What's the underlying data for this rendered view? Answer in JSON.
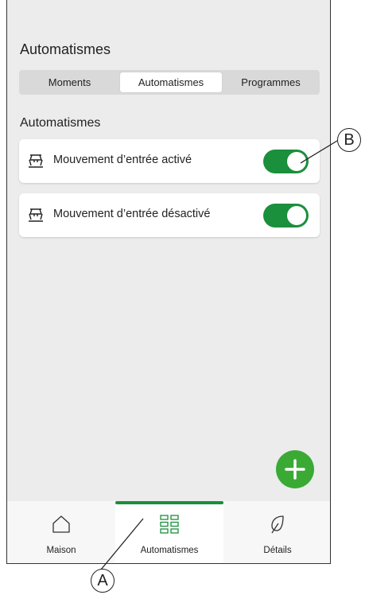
{
  "header": {
    "title": "Automatismes"
  },
  "tabs": [
    {
      "label": "Moments",
      "active": false
    },
    {
      "label": "Automatismes",
      "active": true
    },
    {
      "label": "Programmes",
      "active": false
    }
  ],
  "section": {
    "title": "Automatismes"
  },
  "automations": [
    {
      "label": "Mouvement d’entrée activé",
      "icon": "motion-sensor-icon",
      "enabled": true
    },
    {
      "label": "Mouvement d’entrée désactivé",
      "icon": "motion-sensor-icon",
      "enabled": true
    }
  ],
  "fab": {
    "icon": "plus-icon"
  },
  "bottom_nav": {
    "items": [
      {
        "label": "Maison",
        "icon": "home-icon",
        "active": false
      },
      {
        "label": "Automatismes",
        "icon": "grid-icon",
        "active": true
      },
      {
        "label": "Détails",
        "icon": "leaf-icon",
        "active": false
      }
    ]
  },
  "callouts": {
    "a": "A",
    "b": "B"
  },
  "colors": {
    "accent_green": "#1a8f3c",
    "fab_green": "#3aaa35",
    "background": "#ececec"
  }
}
